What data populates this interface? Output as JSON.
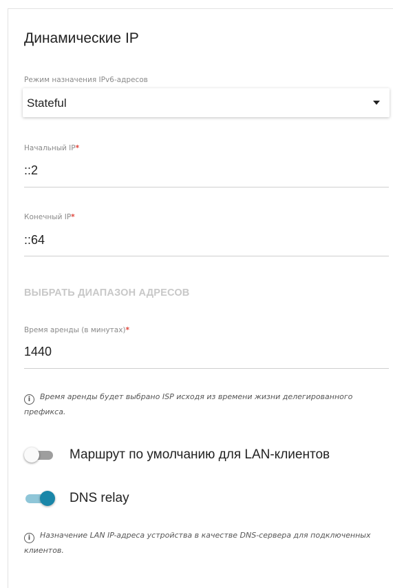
{
  "section": {
    "title": "Динамические IP"
  },
  "ipv6_mode": {
    "label": "Режим назначения IPv6-адресов",
    "value": "Stateful"
  },
  "start_ip": {
    "label": "Начальный IP",
    "required_mark": "*",
    "value": "::2"
  },
  "end_ip": {
    "label": "Конечный IP",
    "required_mark": "*",
    "value": "::64"
  },
  "select_range": {
    "label": "ВЫБРАТЬ ДИАПАЗОН АДРЕСОВ"
  },
  "lease_time": {
    "label": "Время аренды (в минутах)",
    "required_mark": "*",
    "value": "1440"
  },
  "lease_hint": {
    "icon": "info-icon",
    "text": "Время аренды будет выбрано ISP исходя из времени жизни делегированного префикса."
  },
  "default_route_toggle": {
    "label": "Маршрут по умолчанию для LAN-клиентов",
    "checked": false
  },
  "dns_relay_toggle": {
    "label": "DNS relay",
    "checked": true
  },
  "dns_hint": {
    "icon": "info-icon",
    "text": "Назначение LAN IP-адреса устройства в качестве DNS-сервера для подключенных клиентов."
  },
  "colors": {
    "accent": "#1a86a8",
    "required": "#e0443a",
    "disabled_text": "#c8c8c8"
  }
}
